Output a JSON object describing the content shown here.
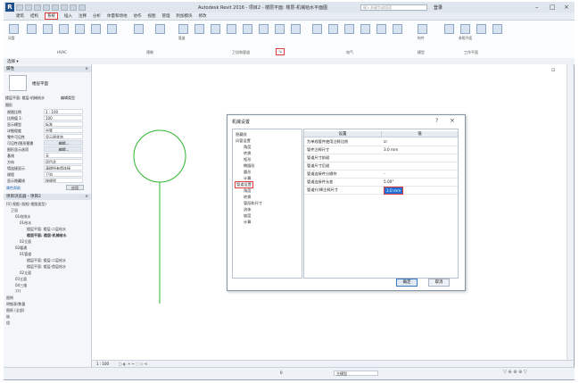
{
  "app": {
    "title": "Autodesk Revit 2016 -   项目2 - 楼层平面: 楼层-机械给水平面图",
    "search_placeholder": "键入关键字或短语",
    "user": "登录"
  },
  "ribbon_tabs": [
    "建筑",
    "结构",
    "系统",
    "插入",
    "注释",
    "分析",
    "体量和场地",
    "协作",
    "视图",
    "管理",
    "附加模块",
    "修改"
  ],
  "active_tab": "系统",
  "ribbon": {
    "panels": [
      "HVAC",
      "预制",
      "卫浴和管道",
      "电气",
      "模型",
      "工作平面"
    ],
    "buttons": [
      "风管",
      "风管占位符",
      "转换为软风管",
      "风管管件",
      "风管附件",
      "软风管",
      "风道末端",
      "机械设备",
      "管道",
      "管道占位符",
      "平行管道",
      "管件",
      "管路附件",
      "软管",
      "卫浴装置",
      "喷头",
      "电缆桥架",
      "线管",
      "照明设备",
      "构件",
      "参照平面",
      "设置"
    ]
  },
  "select_label": "选择 ▾",
  "properties": {
    "header": "属性",
    "type_name": "楼层平面",
    "selector": "楼层平面: 楼层-机械给水",
    "edit_type": "编辑类型",
    "group": "图形",
    "rows": [
      {
        "k": "视图比例",
        "v": "1 : 100"
      },
      {
        "k": "比例值 1:",
        "v": "100"
      },
      {
        "k": "显示模型",
        "v": "标准"
      },
      {
        "k": "详细程度",
        "v": "中等"
      },
      {
        "k": "零件可见性",
        "v": "显示原状态"
      },
      {
        "k": "可见性/图形替换",
        "v": "编辑..."
      },
      {
        "k": "图形显示选项",
        "v": "编辑..."
      },
      {
        "k": "基线",
        "v": "无"
      },
      {
        "k": "方向",
        "v": "项目北"
      },
      {
        "k": "墙连接显示",
        "v": "清理所有墙连接"
      },
      {
        "k": "规程",
        "v": "卫浴"
      },
      {
        "k": "显示隐藏线",
        "v": "按规程"
      }
    ],
    "help": "属性帮助",
    "apply": "应用"
  },
  "browser": {
    "header": "项目浏览器 - 项目2",
    "items": [
      "[0] 视图 (规程-视图类型)",
      "卫浴",
      "01给排水",
      "01给水",
      "楼层平面: 楼层-二层给水",
      "楼层平面: 楼层-机械给水",
      "02立面",
      "02暖通",
      "01管道",
      "楼层平面: 楼层-二层给水",
      "楼层平面: 楼层-首层给水",
      "02立面",
      "03立面",
      "04三维",
      "???",
      "图例",
      "明细表/数量",
      "图纸 (全部)",
      "族",
      "组"
    ]
  },
  "dialog": {
    "title": "机械设置",
    "help": "?",
    "tree": [
      "隐藏线",
      "风管设置",
      "角度",
      "转换",
      "矩形",
      "椭圆形",
      "圆形",
      "计算",
      "管道设置",
      "角度",
      "转换",
      "管段和尺寸",
      "流体",
      "坡度",
      "计算"
    ],
    "selected_tree_item": "管道设置",
    "col_setting": "设置",
    "col_value": "值",
    "rows": [
      {
        "k": "为单线管件使用注释比例",
        "v": "☑"
      },
      {
        "k": "管件注释尺寸",
        "v": "3.0 mm"
      },
      {
        "k": "管道尺寸前缀",
        "v": ""
      },
      {
        "k": "管道尺寸后缀",
        "v": ""
      },
      {
        "k": "管道连接件分隔符",
        "v": "-"
      },
      {
        "k": "管道连接件允差",
        "v": "5.00°"
      },
      {
        "k": "管道升/降注释尺寸",
        "v": "3.0 mm"
      }
    ],
    "ok": "确定",
    "cancel": "取消"
  },
  "status": {
    "scale": "1 : 100",
    "model": "主模型",
    "zoom_label": "0"
  }
}
